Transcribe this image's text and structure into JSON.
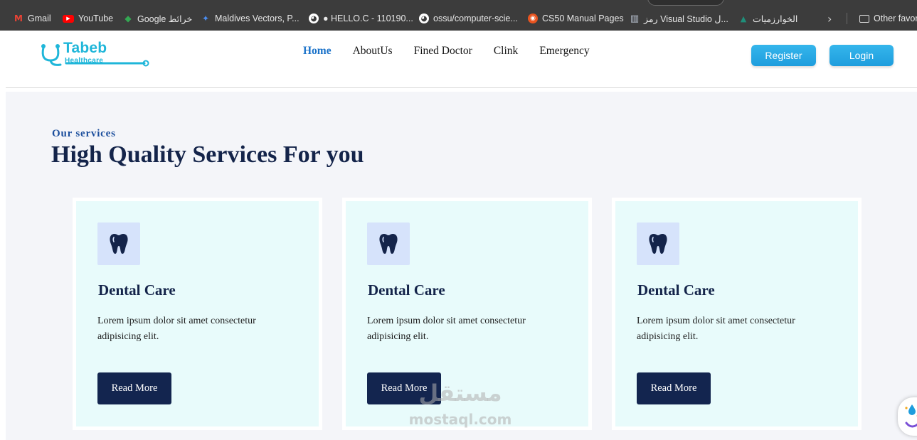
{
  "bookmarks": {
    "items": [
      {
        "label": "Gmail",
        "icon": "gmail-icon",
        "color": "#ea4335",
        "glyph": "M"
      },
      {
        "label": "YouTube",
        "icon": "youtube-icon",
        "color": "#ff0000",
        "glyph": "▶"
      },
      {
        "label": "Google خرائط",
        "icon": "google-maps-icon",
        "color": "#34a853",
        "glyph": "◆"
      },
      {
        "label": "Maldives Vectors, P...",
        "icon": "vector-site-icon",
        "color": "#2b6cd6",
        "glyph": "✦"
      },
      {
        "label": "● HELLO.C - 110190...",
        "icon": "github-icon",
        "color": "#ffffff",
        "glyph": "●"
      },
      {
        "label": "ossu/computer-scie...",
        "icon": "github-icon",
        "color": "#ffffff",
        "glyph": "●"
      },
      {
        "label": "CS50 Manual Pages",
        "icon": "ubuntu-icon",
        "color": "#e95420",
        "glyph": "◉"
      },
      {
        "label": "رمز Visual Studio ل...",
        "icon": "visual-studio-icon",
        "color": "#9aa4b4",
        "glyph": "▥"
      },
      {
        "label": "الخوارزميات",
        "icon": "algorithms-site-icon",
        "color": "#1f8f7a",
        "glyph": "▲"
      }
    ],
    "overflow_label": "Other favor"
  },
  "header": {
    "logo": {
      "name": "Tabeb",
      "sub": "Healthcare"
    },
    "nav": [
      {
        "label": "Home",
        "active": true
      },
      {
        "label": "AboutUs",
        "active": false
      },
      {
        "label": "Fined Doctor",
        "active": false
      },
      {
        "label": "Clink",
        "active": false
      },
      {
        "label": "Emergency",
        "active": false
      }
    ],
    "register_label": "Register",
    "login_label": "Login"
  },
  "services": {
    "eyebrow": "Our services",
    "title": "High Quality Services For you",
    "cards": [
      {
        "title": "Dental Care",
        "text": "Lorem ipsum dolor sit amet consectetur adipisicing elit.",
        "button": "Read More",
        "icon": "tooth-icon"
      },
      {
        "title": "Dental Care",
        "text": "Lorem ipsum dolor sit amet consectetur adipisicing elit.",
        "button": "Read More",
        "icon": "tooth-icon"
      },
      {
        "title": "Dental Care",
        "text": "Lorem ipsum dolor sit amet consectetur adipisicing elit.",
        "button": "Read More",
        "icon": "tooth-icon"
      }
    ]
  },
  "watermark": {
    "arabic": "مستقل",
    "latin": "mostaql.com"
  },
  "colors": {
    "brand": "#1fb6d9",
    "nav_active": "#1a72c9",
    "navy": "#14244a",
    "button_navy": "#13254f",
    "card_bg": "#e8fbfb",
    "icon_bg": "#d6e3fb",
    "header_button": "#1e9ddd"
  }
}
